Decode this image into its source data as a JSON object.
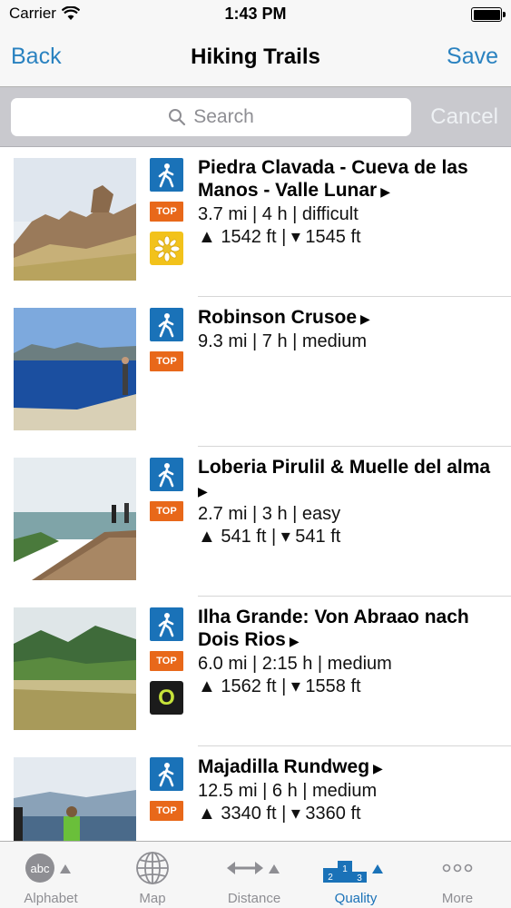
{
  "status": {
    "carrier": "Carrier",
    "time": "1:43 PM"
  },
  "nav": {
    "back_label": "Back",
    "title": "Hiking Trails",
    "save_label": "Save"
  },
  "search": {
    "placeholder": "Search",
    "cancel_label": "Cancel"
  },
  "trails": [
    {
      "name": "Piedra Clavada - Cueva de las Manos - Valle Lunar",
      "stats": "3.7 mi | 4 h | difficult",
      "elevation": "▲ 1542 ft | ▾ 1545 ft",
      "top_label": "TOP",
      "special_badge": "edelweiss-icon"
    },
    {
      "name": "Robinson Crusoe",
      "stats": "9.3 mi | 7 h | medium",
      "elevation": "",
      "top_label": "TOP",
      "special_badge": ""
    },
    {
      "name": "Loberia Pirulil & Muelle del alma",
      "stats": "2.7 mi | 3 h | easy",
      "elevation": "▲ 541 ft | ▾ 541 ft",
      "top_label": "TOP",
      "special_badge": ""
    },
    {
      "name": "Ilha Grande: Von Abraao nach Dois Rios",
      "stats": "6.0 mi | 2:15 h | medium",
      "elevation": "▲ 1562 ft | ▾ 1558 ft",
      "top_label": "TOP",
      "special_badge": "outdooractive-icon",
      "special_text": "O"
    },
    {
      "name": "Majadilla Rundweg",
      "stats": "12.5 mi | 6 h | medium",
      "elevation": "▲ 3340 ft | ▾ 3360 ft",
      "top_label": "TOP",
      "special_badge": ""
    }
  ],
  "tabs": [
    {
      "label": "Alphabet",
      "icon": "abc-sort-icon",
      "icon_text": "abc"
    },
    {
      "label": "Map",
      "icon": "globe-icon"
    },
    {
      "label": "Distance",
      "icon": "distance-arrows-icon"
    },
    {
      "label": "Quality",
      "icon": "podium-icon",
      "active": true,
      "podium": [
        "2",
        "1",
        "3"
      ]
    },
    {
      "label": "More",
      "icon": "more-dots-icon",
      "icon_text": "ooo"
    }
  ],
  "colors": {
    "accent": "#2a82c0",
    "hike_badge": "#1a72b8",
    "top_badge": "#e8681a",
    "active_tab": "#1a72b8"
  }
}
